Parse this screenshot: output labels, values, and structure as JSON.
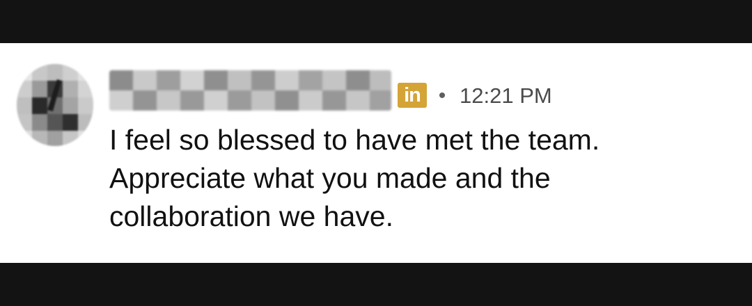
{
  "message": {
    "sender_badge": "in",
    "separator": "•",
    "timestamp": "12:21 PM",
    "lines": [
      "I feel so blessed to have met the team.",
      "Appreciate what you made and the",
      "collaboration we have."
    ]
  },
  "colors": {
    "background": "#131313",
    "card": "#ffffff",
    "badge": "#d4a437",
    "text": "#111111",
    "meta": "#4a4a4a"
  },
  "icons": {
    "avatar": "pixelated-avatar",
    "badge": "linkedin-icon"
  }
}
